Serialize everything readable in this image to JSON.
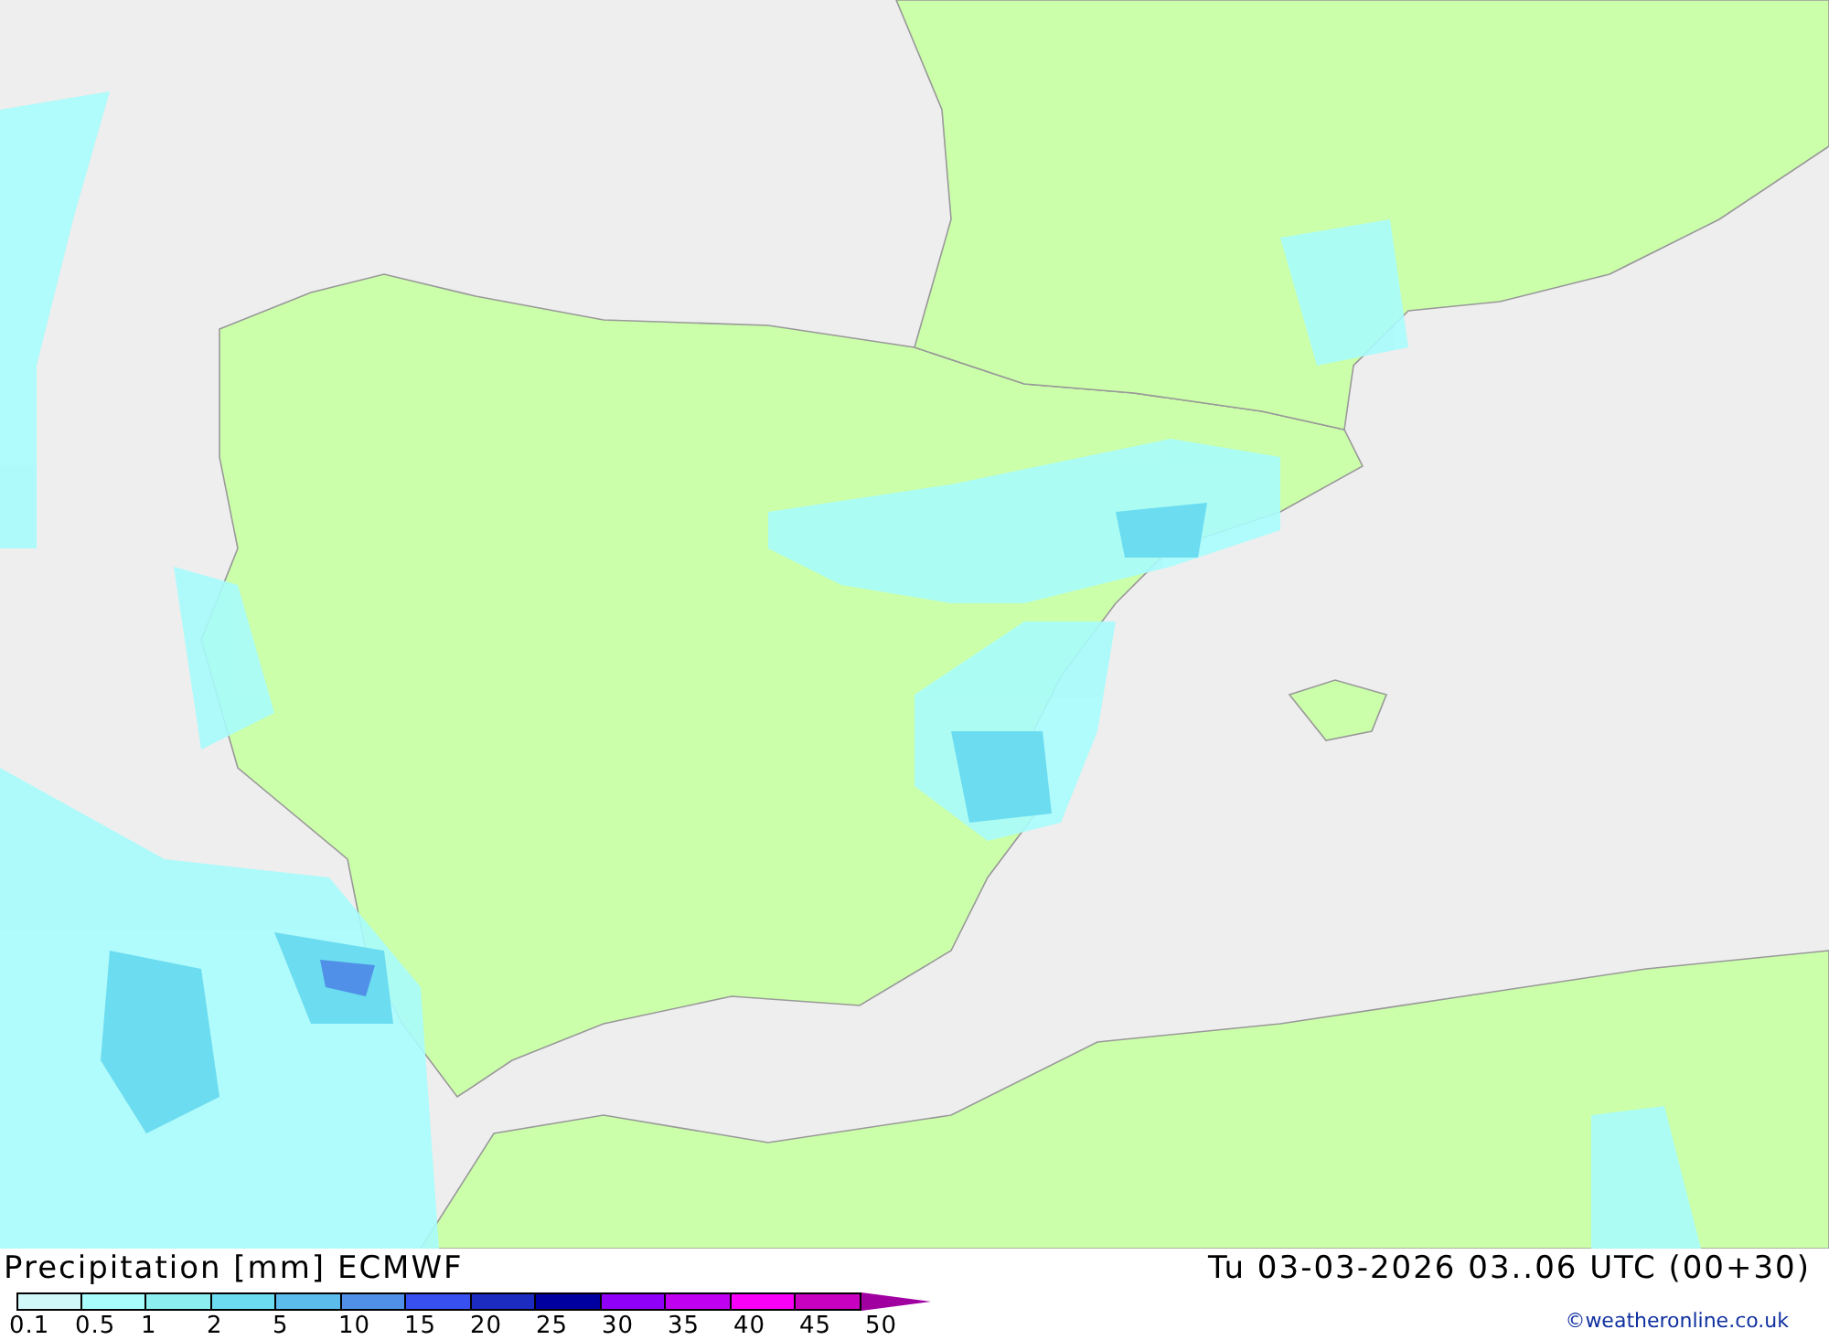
{
  "map": {
    "title": "Precipitation [mm] ECMWF",
    "valid_time": "Tu 03-03-2026 03..06 UTC (00+30)"
  },
  "legend": {
    "boxes": [
      {
        "color": "#d0f8f8"
      },
      {
        "color": "#a8fcfc"
      },
      {
        "color": "#8ceeee"
      },
      {
        "color": "#6cdcf0"
      },
      {
        "color": "#5cbcec"
      },
      {
        "color": "#5090e8"
      },
      {
        "color": "#3850f0"
      },
      {
        "color": "#1c2cc0"
      },
      {
        "color": "#0000a0"
      },
      {
        "color": "#9000f8"
      },
      {
        "color": "#c000f0"
      },
      {
        "color": "#f800f8"
      },
      {
        "color": "#c800c0"
      }
    ],
    "labels": [
      "0.1",
      "0.5",
      "1",
      "2",
      "5",
      "10",
      "15",
      "20",
      "25",
      "30",
      "35",
      "40",
      "45",
      "50"
    ]
  },
  "credit": "©weatheronline.co.uk"
}
